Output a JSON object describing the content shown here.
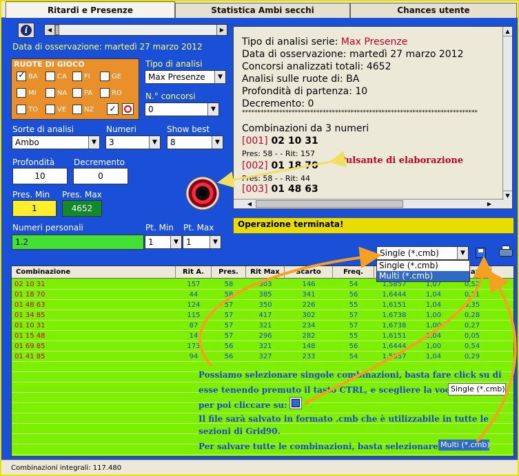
{
  "tabs": [
    "Ritardi e Presenze",
    "Statistica Ambi secchi",
    "Chances utente"
  ],
  "data_osservazione_label": "Data di osservazione:",
  "data_osservazione_value": "martedì 27 marzo 2012",
  "ruote": {
    "title": "RUOTE DI GIOCO",
    "items": [
      {
        "label": "BA",
        "checked": true
      },
      {
        "label": "CA",
        "checked": false
      },
      {
        "label": "FI",
        "checked": false
      },
      {
        "label": "GE",
        "checked": false
      },
      {
        "label": "MI",
        "checked": false
      },
      {
        "label": "NA",
        "checked": false
      },
      {
        "label": "PA",
        "checked": false
      },
      {
        "label": "RO",
        "checked": false
      },
      {
        "label": "TO",
        "checked": false
      },
      {
        "label": "VE",
        "checked": false
      },
      {
        "label": "NZ",
        "checked": false
      }
    ]
  },
  "tipo_analisi": {
    "label": "Tipo di analisi",
    "value": "Max Presenze"
  },
  "n_concorsi": {
    "label": "N.° concorsi",
    "value": "0"
  },
  "sorte": {
    "label": "Sorte di analisi",
    "value": "Ambo"
  },
  "numeri": {
    "label": "Numeri",
    "value": "3"
  },
  "show_best": {
    "label": "Show best",
    "value": "8"
  },
  "profondita": {
    "label": "Profondità",
    "value": "10"
  },
  "decremento": {
    "label": "Decremento",
    "value": "0"
  },
  "pres_min": {
    "label": "Pres. Min",
    "value": "1"
  },
  "pres_max": {
    "label": "Pres. Max",
    "value": "4652"
  },
  "numeri_personali": {
    "label": "Numeri personali",
    "value": "1.2"
  },
  "pt_min": {
    "label": "Pt. Min",
    "value": "1"
  },
  "pt_max": {
    "label": "Pt. Max",
    "value": "1"
  },
  "info": {
    "l1_label": "Tipo di analisi serie: ",
    "l1_value": "Max Presenze",
    "l2": "Data di osservazione: martedì 27 marzo 2012",
    "l3": "Concorsi analizzati totali: 4652",
    "l4": "Analisi sulle ruote di: BA",
    "l5": "Profondità di partenza: 10",
    "l6": "Decremento: 0",
    "stars": "****************************************************************************",
    "comb_title": "Combinazioni da 3 numeri",
    "c1_id": "[001]",
    "c1_nums": "02 10 31",
    "c1_stats": "Pres: 58 - - Rit: 157",
    "c2_id": "[002]",
    "c2_nums": "01 18 70",
    "c2_stats": "Pres: 58 - - Rit: 44",
    "c3_id": "[003]",
    "c3_nums": "01 48 63"
  },
  "status": "Operazione terminata!",
  "annotation_elab": "Pulsante di elaborazione",
  "save_format": {
    "selected": "Single (*.cmb)",
    "options": [
      "Single (*.cmb)",
      "Multi (*.cmb)"
    ]
  },
  "grid": {
    "headers": [
      "Combinazione",
      "Rit A.",
      "Pres.",
      "Rit Max",
      "Scarto",
      "Freq.",
      "",
      "",
      "Max"
    ],
    "rows": [
      [
        "02 10 31",
        "157",
        "58",
        "303",
        "146",
        "54",
        "1,5857",
        "1,07",
        "0,52"
      ],
      [
        "01 18 70",
        "44",
        "58",
        "385",
        "341",
        "56",
        "1,6444",
        "1,04",
        "0,11"
      ],
      [
        "01 48 63",
        "124",
        "57",
        "350",
        "226",
        "55",
        "1,6151",
        "1,04",
        "0,35"
      ],
      [
        "01 34 85",
        "115",
        "57",
        "417",
        "302",
        "57",
        "1,6738",
        "1,00",
        "0,28"
      ],
      [
        "01 10 31",
        "87",
        "57",
        "321",
        "234",
        "57",
        "1,6738",
        "1,00",
        "0,27"
      ],
      [
        "01 15 48",
        "14",
        "57",
        "296",
        "282",
        "55",
        "1,6151",
        "1,04",
        "0,05"
      ],
      [
        "01 69 85",
        "173",
        "56",
        "321",
        "148",
        "56",
        "1,6444",
        "1,00",
        "0,54"
      ],
      [
        "01 41 85",
        "94",
        "56",
        "327",
        "233",
        "54",
        "1,5857",
        "1,04",
        "0,29"
      ]
    ]
  },
  "notes": {
    "n1": "Possiamo selezionare singole combinazioni, basta fare click su di",
    "n2": "esse tenendo premuto il tasto CTRL, e scegliere la voce",
    "n2_chip": "Single (*.cmb)",
    "n3": "per poi cliccare su:",
    "n4": "Il file sarà salvato in formato .cmb che è utilizzabile in tutte le",
    "n5": "sezioni di Grid90.",
    "n6": "Per salvare tutte le combinazioni, basta selezionare:",
    "n6_chip": "Multi (*.cmb)"
  },
  "footer": "Combinazioni integrali: 117.480",
  "colors": {
    "bg": "#1a4fd8",
    "grid": "#7cf000",
    "orange": "#e9902a",
    "accent_arrow": "#f5a020"
  }
}
